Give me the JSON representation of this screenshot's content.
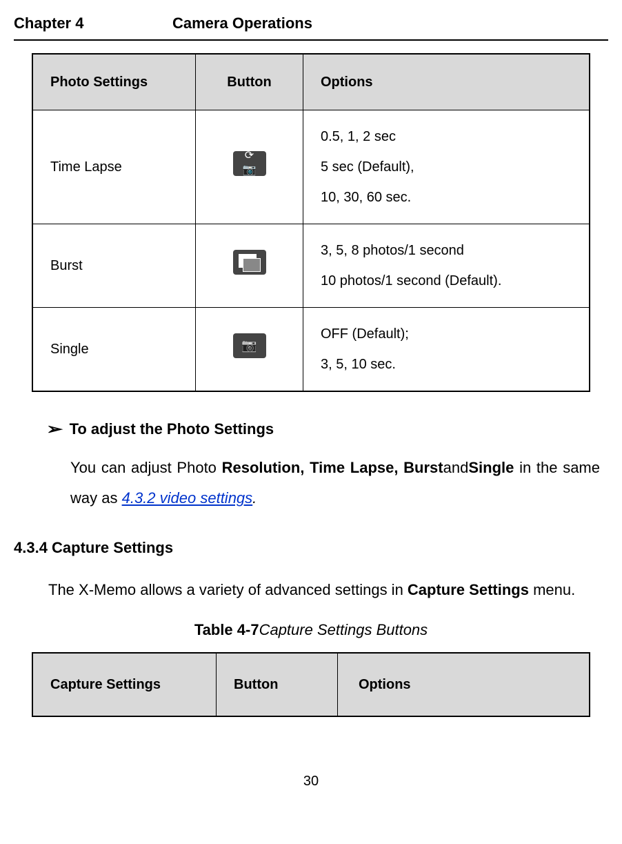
{
  "header": {
    "chapter": "Chapter 4",
    "title": "Camera Operations"
  },
  "photo_table": {
    "headers": [
      "Photo Settings",
      "Button",
      "Options"
    ],
    "rows": [
      {
        "name": "Time Lapse",
        "icon": "timelapse-icon",
        "options": "0.5, 1, 2 sec<br>5 sec (Default),<br>10, 30, 60 sec."
      },
      {
        "name": "Burst",
        "icon": "burst-icon",
        "options": "3, 5, 8 photos/1 second<br>10 photos/1 second (Default)."
      },
      {
        "name": "Single",
        "icon": "single-icon",
        "options": "OFF (Default);<br>3, 5, 10 sec."
      }
    ]
  },
  "bullet": {
    "arrow": "➢",
    "heading": "To adjust the Photo Settings",
    "body_pre": "You can adjust Photo ",
    "bold1": "Resolution, Time Lapse, Burst",
    "mid": "and",
    "bold2": "Single",
    "post": " in the same way as ",
    "link": "4.3.2 video settings",
    "end": "."
  },
  "section": {
    "heading": "4.3.4 Capture Settings",
    "body_pre": "The X-Memo allows a variety of advanced settings in ",
    "bold": "Capture Settings",
    "post": " menu."
  },
  "caption": {
    "label": "Table 4-7",
    "text": "Capture Settings Buttons"
  },
  "capture_table": {
    "headers": [
      "Capture Settings",
      "Button",
      "Options"
    ]
  },
  "page_number": "30"
}
